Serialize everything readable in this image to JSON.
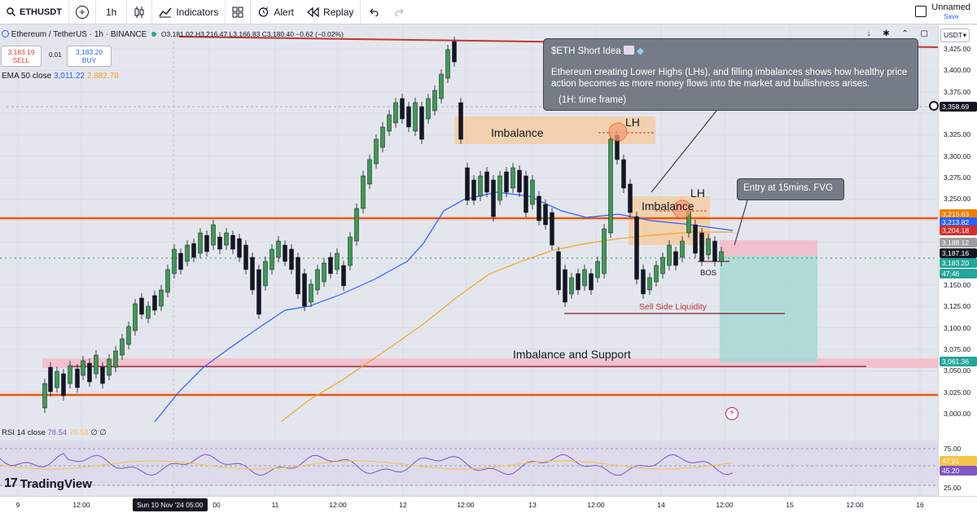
{
  "toolbar": {
    "symbol": "ETHUSDT",
    "interval": "1h",
    "indicators_label": "Indicators",
    "alert_label": "Alert",
    "replay_label": "Replay",
    "layout_name": "Unnamed",
    "save_label": "Save"
  },
  "legend": {
    "instrument": "Ethereum / TetherUS · 1h · BINANCE",
    "ohlc": "O3,181.02 H3,216.47 L3,166.83 C3,180.40 −0.62 (−0.02%)",
    "sell_price": "3,183.19",
    "sell_label": "SELL",
    "spread": "0.01",
    "buy_price": "3,183.20",
    "buy_label": "BUY",
    "ema_label": "EMA 50 close",
    "ema_value_1": "3,011.22",
    "ema_value_2": "2,882.78"
  },
  "idea": {
    "title": "$ETH Short Idea",
    "body": "Ethereum creating Lower Highs (LHs), and filling imbalances shows how healthy price action becomes as more money flows into the market and bullishness arises.",
    "timeframe": "(1H: time frame)"
  },
  "annotations": {
    "imbalance_top": "Imbalance",
    "lh_top": "LH",
    "imbalance_mid": "Imbalance",
    "lh_mid": "LH",
    "entry": "Entry at 15mins. FVG",
    "bos": "BOS",
    "sell_side_liquidity": "Sell Side Liquidity",
    "imbalance_support": "Imbalance and Support"
  },
  "rsi": {
    "label": "RSI 14 close",
    "value": "78.54",
    "smoothed": "70.58",
    "extra": "∅ ∅"
  },
  "price_scale": {
    "currency": "USDT",
    "ticks": [
      "3,425.00",
      "3,400.00",
      "3,375.00",
      "3,325.00",
      "3,300.00",
      "3,275.00",
      "3,250.00",
      "3,150.00",
      "3,125.00",
      "3,100.00",
      "3,075.00",
      "3,050.00",
      "3,025.00",
      "3,000.00"
    ],
    "labels": [
      {
        "text": "3,358.69",
        "color": "#131722"
      },
      {
        "text": "3,215.63",
        "color": "#f57c00"
      },
      {
        "text": "3,213.82",
        "color": "#2962ff"
      },
      {
        "text": "3,204.18",
        "color": "#d32f2f"
      },
      {
        "text": "3,188.12",
        "color": "#9e9e9e"
      },
      {
        "text": "3,187.16",
        "color": "#131722"
      },
      {
        "text": "3,183.20",
        "color": "#26a69a"
      },
      {
        "text": "47:46",
        "color": "#26a69a"
      },
      {
        "text": "3,061.36",
        "color": "#26a69a"
      }
    ],
    "rsi_ticks": [
      "75.00",
      "25.00"
    ],
    "rsi_labels": [
      {
        "text": "47.91",
        "color": "#f6c34a"
      },
      {
        "text": "45.20",
        "color": "#7e57c2"
      }
    ]
  },
  "time_axis": {
    "ticks": [
      "9",
      "12:00",
      "11",
      "12:00",
      "12",
      "12:00",
      "13",
      "12:00",
      "14",
      "12:00",
      "15",
      "12:00",
      "16"
    ],
    "current": "Sun 10 Nov '24  05:00",
    "after_current": "00"
  },
  "brand": {
    "name": "TradingView"
  },
  "colors": {
    "up": "#3d9a52",
    "down": "#131722",
    "ema_fast": "#2962ff",
    "ema_slow": "#f5a623",
    "level": "#e8590c",
    "imbalance_fill": "#f6c99a",
    "support_fill": "#f4b8c6",
    "target_fill": "#a7d8d4",
    "rsi_line": "#7e57c2",
    "rsi_ma": "#f6c34a"
  }
}
